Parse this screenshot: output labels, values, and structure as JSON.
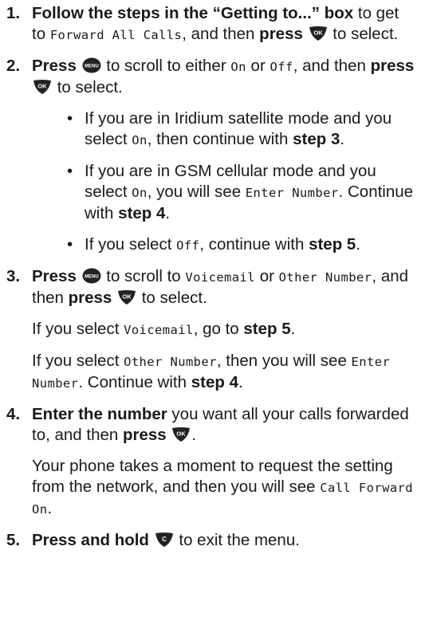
{
  "icons": {
    "ok": {
      "name": "ok-key-icon",
      "label": "OK"
    },
    "menu": {
      "name": "menu-key-icon",
      "label": "MENU"
    },
    "c": {
      "name": "c-key-icon",
      "label": "C"
    }
  },
  "steps": [
    {
      "num": "1.",
      "lead": "Follow the steps in the “Getting to...” box",
      "t1": "to get to",
      "lcd1": "Forward All Calls",
      "t2": ", and then",
      "press": "press",
      "t3": "to select."
    },
    {
      "num": "2.",
      "press": "Press",
      "t1": "to scroll to either",
      "lcd_on": "On",
      "t2": "or",
      "lcd_off": "Off",
      "t3": ", and then",
      "press2": "press",
      "t4": "to select.",
      "bullets": [
        {
          "t1": "If you are in Iridium satellite mode and you select",
          "lcd1": "On",
          "t2": ", then continue with",
          "bold": "step 3",
          "t3": "."
        },
        {
          "t1": "If you are in GSM cellular mode and you select",
          "lcd1": "On",
          "t2": ", you will see",
          "lcd2": "Enter Number",
          "t3": ". Continue with",
          "bold": "step 4",
          "t4": "."
        },
        {
          "t1": "If you select",
          "lcd1": "Off",
          "t2": ", continue with",
          "bold": "step 5",
          "t3": "."
        }
      ]
    },
    {
      "num": "3.",
      "press": "Press",
      "t1": "to scroll to",
      "lcd1": "Voicemail",
      "t2": "or",
      "lcd2": "Other Number",
      "t3": ", and then",
      "press2": "press",
      "t4": "to select.",
      "p2": {
        "t1": "If you select",
        "lcd1": "Voicemail",
        "t2": ", go to",
        "bold": "step 5",
        "t3": "."
      },
      "p3": {
        "t1": "If you select",
        "lcd1": "Other Number",
        "t2": ", then you will see",
        "lcd2": "Enter Number",
        "t3": ". Continue with",
        "bold": "step 4",
        "t4": "."
      }
    },
    {
      "num": "4.",
      "lead": "Enter the number",
      "t1": "you want all your calls forwarded to, and then",
      "press": "press",
      "t2": ".",
      "p2": {
        "t1": "Your phone takes a moment to request the setting from the network, and then you will see",
        "lcd1": "Call Forward On",
        "t2": "."
      }
    },
    {
      "num": "5.",
      "lead": "Press and hold",
      "t1": "to exit the menu."
    }
  ]
}
